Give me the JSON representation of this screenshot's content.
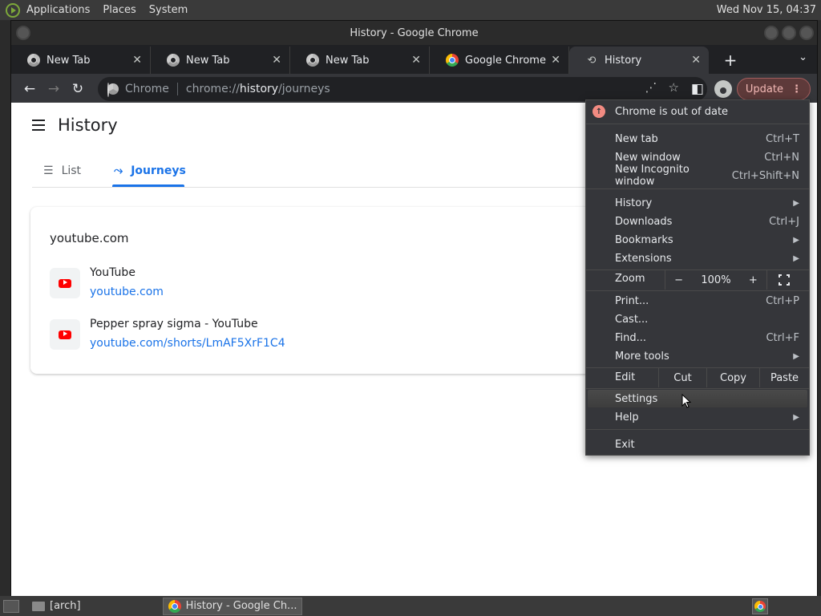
{
  "system_panel": {
    "menus": [
      "Applications",
      "Places",
      "System"
    ],
    "clock": "Wed Nov 15, 04:37"
  },
  "window": {
    "title": "History - Google Chrome"
  },
  "tabs": [
    {
      "title": "New Tab",
      "icon": "chrome-gray-icon"
    },
    {
      "title": "New Tab",
      "icon": "chrome-gray-icon"
    },
    {
      "title": "New Tab",
      "icon": "chrome-gray-icon"
    },
    {
      "title": "Google Chrome - T",
      "icon": "chrome-color-icon"
    },
    {
      "title": "History",
      "icon": "history-icon",
      "active": true
    }
  ],
  "toolbar": {
    "site_label": "Chrome",
    "url_scheme": "chrome://",
    "url_host": "history",
    "url_path": "/journeys",
    "update_label": "Update"
  },
  "page": {
    "title": "History",
    "tabs": [
      {
        "label": "List",
        "active": false
      },
      {
        "label": "Journeys",
        "active": true
      }
    ],
    "cluster": {
      "domain": "youtube.com",
      "visits": [
        {
          "title": "YouTube",
          "url": "youtube.com"
        },
        {
          "title": "Pepper spray sigma - YouTube",
          "url": "youtube.com/shorts/LmAF5XrF1C4"
        }
      ]
    }
  },
  "menu": {
    "out_of_date": "Chrome is out of date",
    "new_tab": {
      "label": "New tab",
      "shortcut": "Ctrl+T"
    },
    "new_window": {
      "label": "New window",
      "shortcut": "Ctrl+N"
    },
    "new_incognito": {
      "label": "New Incognito window",
      "shortcut": "Ctrl+Shift+N"
    },
    "history": "History",
    "downloads": {
      "label": "Downloads",
      "shortcut": "Ctrl+J"
    },
    "bookmarks": "Bookmarks",
    "extensions": "Extensions",
    "zoom": {
      "label": "Zoom",
      "minus": "−",
      "value": "100%",
      "plus": "+"
    },
    "print": {
      "label": "Print...",
      "shortcut": "Ctrl+P"
    },
    "cast": "Cast...",
    "find": {
      "label": "Find...",
      "shortcut": "Ctrl+F"
    },
    "more_tools": "More tools",
    "edit": {
      "label": "Edit",
      "cut": "Cut",
      "copy": "Copy",
      "paste": "Paste"
    },
    "settings": "Settings",
    "help": "Help",
    "exit": "Exit"
  },
  "taskbar": {
    "tasks": [
      {
        "label": "[arch]",
        "active": false
      },
      {
        "label": "History - Google Ch...",
        "active": true
      }
    ]
  }
}
